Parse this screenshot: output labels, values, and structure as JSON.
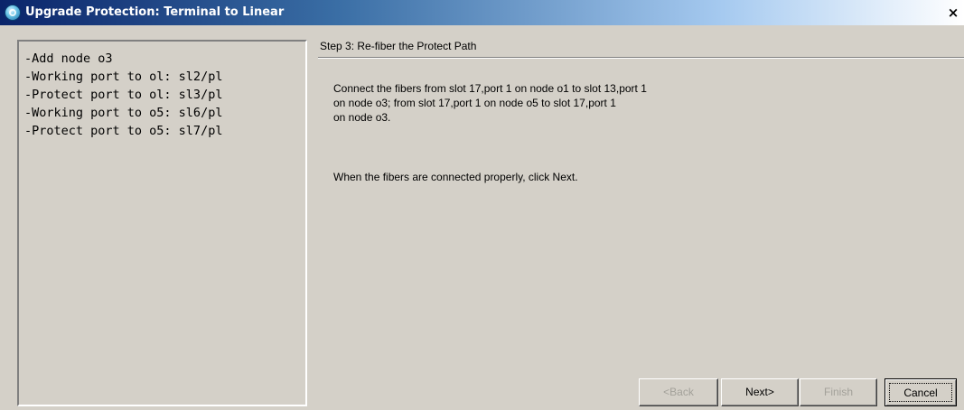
{
  "window": {
    "title": "Upgrade Protection: Terminal to Linear",
    "close_glyph": "×",
    "icon": "app-globe-icon"
  },
  "summary": {
    "items": [
      "-Add node o3",
      "-Working port to ol: sl2/pl",
      "-Protect port to ol: sl3/pl",
      "-Working port to o5: sl6/pl",
      "-Protect port to o5: sl7/pl"
    ]
  },
  "step": {
    "title": "Step 3: Re-fiber the Protect Path",
    "instruction_lines": [
      "Connect the fibers from slot 17,port 1 on node o1 to slot 13,port 1",
      "on node o3; from slot 17,port 1 on node o5 to slot 17,port 1",
      "on node o3."
    ],
    "next_hint": "When the fibers are connected properly, click Next."
  },
  "buttons": {
    "back": "<Back",
    "next": "Next>",
    "finish": "Finish",
    "cancel": "Cancel"
  },
  "colors": {
    "dialog_background": "#d4d0c8",
    "title_gradient_start": "#0a246a",
    "disabled_text": "#a3a19a"
  }
}
